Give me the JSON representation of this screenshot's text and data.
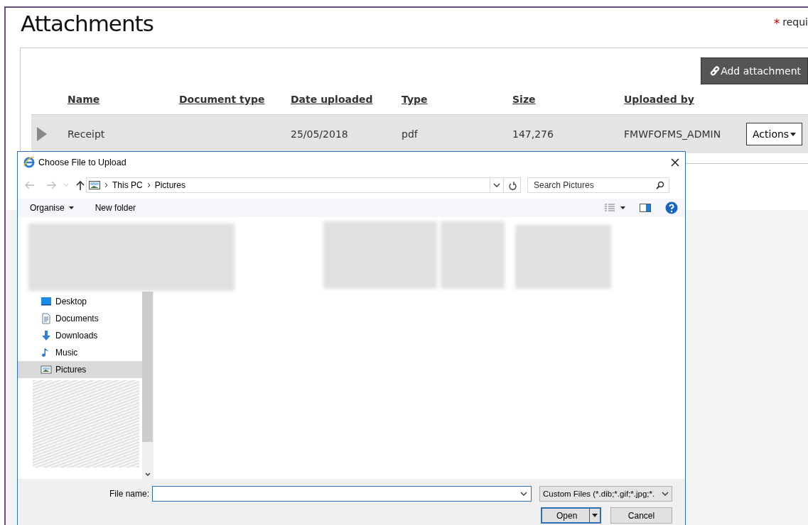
{
  "page": {
    "title": "Attachments",
    "required_mark": "*",
    "required_text": "requi"
  },
  "add_button": {
    "label": "Add attachment"
  },
  "table": {
    "columns": [
      "Name",
      "Document type",
      "Date uploaded",
      "Type",
      "Size",
      "Uploaded by"
    ],
    "rows": [
      {
        "expanded": false,
        "name": "Receipt",
        "date_uploaded": "25/05/2018",
        "type": "pdf",
        "size": "147,276",
        "uploaded_by": "FMWFOFMS_ADMIN",
        "action": "Actions"
      }
    ]
  },
  "dialog": {
    "title": "Choose File to Upload",
    "breadcrumb": [
      "This PC",
      "Pictures"
    ],
    "search": {
      "placeholder": "Search Pictures"
    },
    "toolbar": [
      {
        "label": "Organise",
        "kind": "menu"
      },
      {
        "label": "New folder",
        "kind": "button"
      }
    ],
    "nav_items": [
      {
        "label": "Desktop",
        "kind": "desktop",
        "selected": false
      },
      {
        "label": "Documents",
        "kind": "documents",
        "selected": false
      },
      {
        "label": "Downloads",
        "kind": "downloads",
        "selected": false
      },
      {
        "label": "Music",
        "kind": "music",
        "selected": false
      },
      {
        "label": "Pictures",
        "kind": "pictures",
        "selected": true
      }
    ],
    "file_name": {
      "label": "File name:"
    },
    "file_type": {
      "value": "Custom Files (*.dib;*.gif;*.jpg;*."
    },
    "buttons": [
      {
        "label": "Open",
        "kind": "split"
      },
      {
        "label": "Cancel",
        "kind": "plain"
      }
    ]
  }
}
